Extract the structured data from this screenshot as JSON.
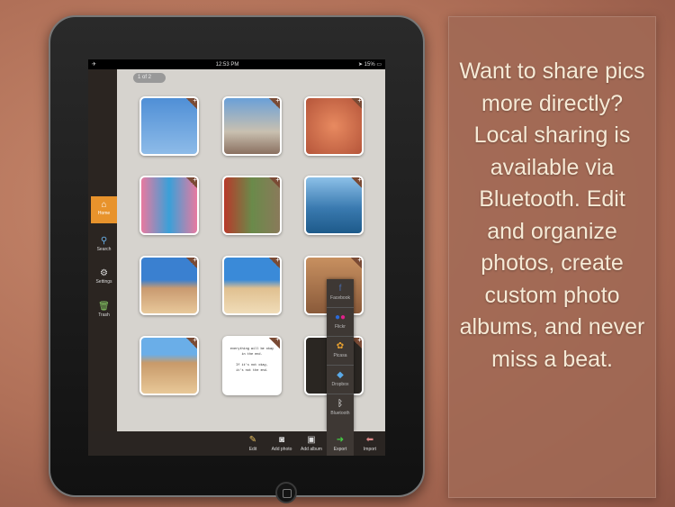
{
  "status_bar": {
    "time": "12:53 PM",
    "battery": "15%",
    "left_icon": "airplane-icon"
  },
  "pager": "1 of 2",
  "sidebar": {
    "items": [
      {
        "label": "Home",
        "icon": "home-icon",
        "active": true
      },
      {
        "label": "Search",
        "icon": "search-icon"
      },
      {
        "label": "Settings",
        "icon": "gear-icon"
      },
      {
        "label": "Trash",
        "icon": "trash-icon"
      }
    ]
  },
  "quote_card": {
    "line1": "everything will be okay",
    "line2": "in the end.",
    "line3": "If it's not okay,",
    "line4": "it's not the end."
  },
  "export_menu": [
    {
      "label": "Facebook",
      "icon": "facebook-icon"
    },
    {
      "label": "Flickr",
      "icon": "flickr-icon"
    },
    {
      "label": "Picasa",
      "icon": "picasa-icon"
    },
    {
      "label": "Dropbox",
      "icon": "dropbox-icon"
    },
    {
      "label": "Bluetooth",
      "icon": "bluetooth-icon"
    }
  ],
  "toolbar": [
    {
      "label": "Edit",
      "icon": "pencil-icon"
    },
    {
      "label": "Add photo",
      "icon": "camera-icon"
    },
    {
      "label": "Add album",
      "icon": "album-icon"
    },
    {
      "label": "Export",
      "icon": "export-icon",
      "active": true
    },
    {
      "label": "Import",
      "icon": "import-icon"
    }
  ],
  "promo_text": "Want to share pics more directly? Local sharing is available via Bluetooth. Edit and organize photos, create custom photo albums, and never miss a beat.",
  "colors": {
    "accent": "#e8932c",
    "panel": "#a06955"
  }
}
